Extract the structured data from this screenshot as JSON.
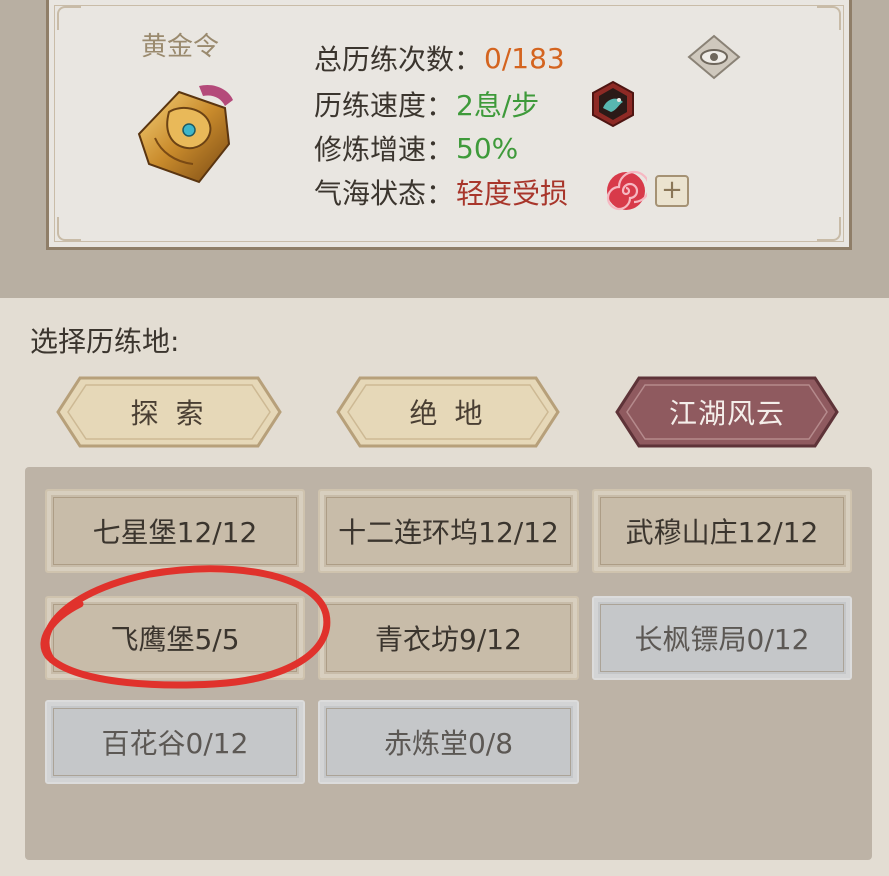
{
  "token": {
    "label": "黄金令",
    "icon": "gold-token-icon"
  },
  "stats": {
    "total_label": "总历练次数：",
    "total_value": "0/183",
    "speed_label": "历练速度：",
    "speed_value": "2息/步",
    "boost_label": "修炼增速：",
    "boost_value": "50%",
    "qi_label": "气海状态：",
    "qi_value": "轻度受损"
  },
  "icons": {
    "eye": "eye-icon",
    "beast": "beast-badge-icon",
    "swirl": "swirl-icon",
    "plus": "+"
  },
  "choose_label": "选择历练地:",
  "tabs": [
    {
      "label": "探 索",
      "active": false
    },
    {
      "label": "绝 地",
      "active": false
    },
    {
      "label": "江湖风云",
      "active": true
    }
  ],
  "locations": [
    {
      "label": "七星堡12/12",
      "active": true
    },
    {
      "label": "十二连环坞12/12",
      "active": true
    },
    {
      "label": "武穆山庄12/12",
      "active": true
    },
    {
      "label": "飞鹰堡5/5",
      "active": true
    },
    {
      "label": "青衣坊9/12",
      "active": true
    },
    {
      "label": "长枫镖局0/12",
      "active": false
    },
    {
      "label": "百花谷0/12",
      "active": false
    },
    {
      "label": "赤炼堂0/8",
      "active": false
    }
  ],
  "colors": {
    "accent_orange": "#d4641f",
    "accent_green": "#3e9a3a",
    "accent_red": "#a8362b",
    "tab_active": "#8f5a5f",
    "tab_inactive": "#e8dcc0",
    "annotation_red": "#e0322c"
  }
}
